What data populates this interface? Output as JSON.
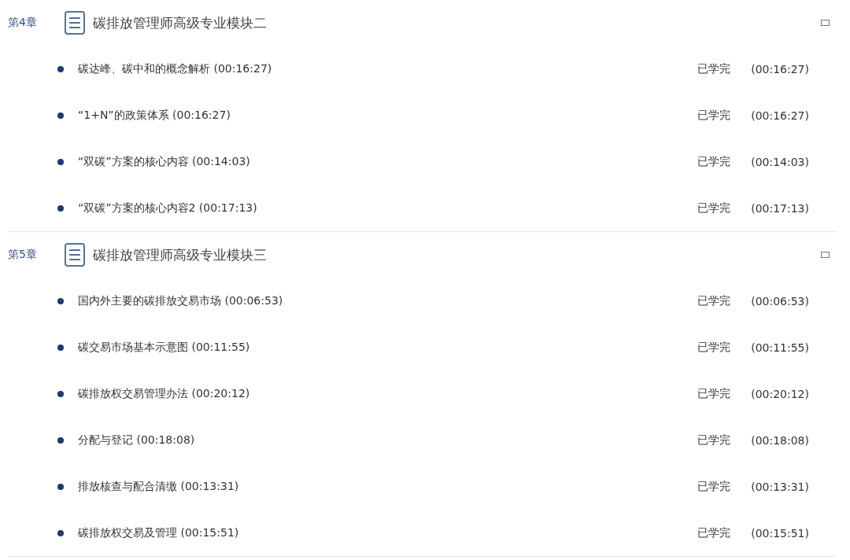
{
  "chapters": [
    {
      "label": "第4章",
      "title": "碳排放管理师高级专业模块二",
      "lessons": [
        {
          "title": "碳达峰、碳中和的概念解析 (00:16:27)",
          "status": "已学完",
          "duration": "(00:16:27)"
        },
        {
          "title": "“1+N”的政策体系 (00:16:27)",
          "status": "已学完",
          "duration": "(00:16:27)"
        },
        {
          "title": "“双碳”方案的核心内容 (00:14:03)",
          "status": "已学完",
          "duration": "(00:14:03)"
        },
        {
          "title": "“双碳”方案的核心内容2 (00:17:13)",
          "status": "已学完",
          "duration": "(00:17:13)"
        }
      ]
    },
    {
      "label": "第5章",
      "title": "碳排放管理师高级专业模块三",
      "lessons": [
        {
          "title": "国内外主要的碳排放交易市场 (00:06:53)",
          "status": "已学完",
          "duration": "(00:06:53)"
        },
        {
          "title": "碳交易市场基本示意图 (00:11:55)",
          "status": "已学完",
          "duration": "(00:11:55)"
        },
        {
          "title": "碳排放权交易管理办法 (00:20:12)",
          "status": "已学完",
          "duration": "(00:20:12)"
        },
        {
          "title": "分配与登记 (00:18:08)",
          "status": "已学完",
          "duration": "(00:18:08)"
        },
        {
          "title": "排放核查与配合清缴 (00:13:31)",
          "status": "已学完",
          "duration": "(00:13:31)"
        },
        {
          "title": "碳排放权交易及管理 (00:15:51)",
          "status": "已学完",
          "duration": "(00:15:51)"
        }
      ]
    }
  ]
}
